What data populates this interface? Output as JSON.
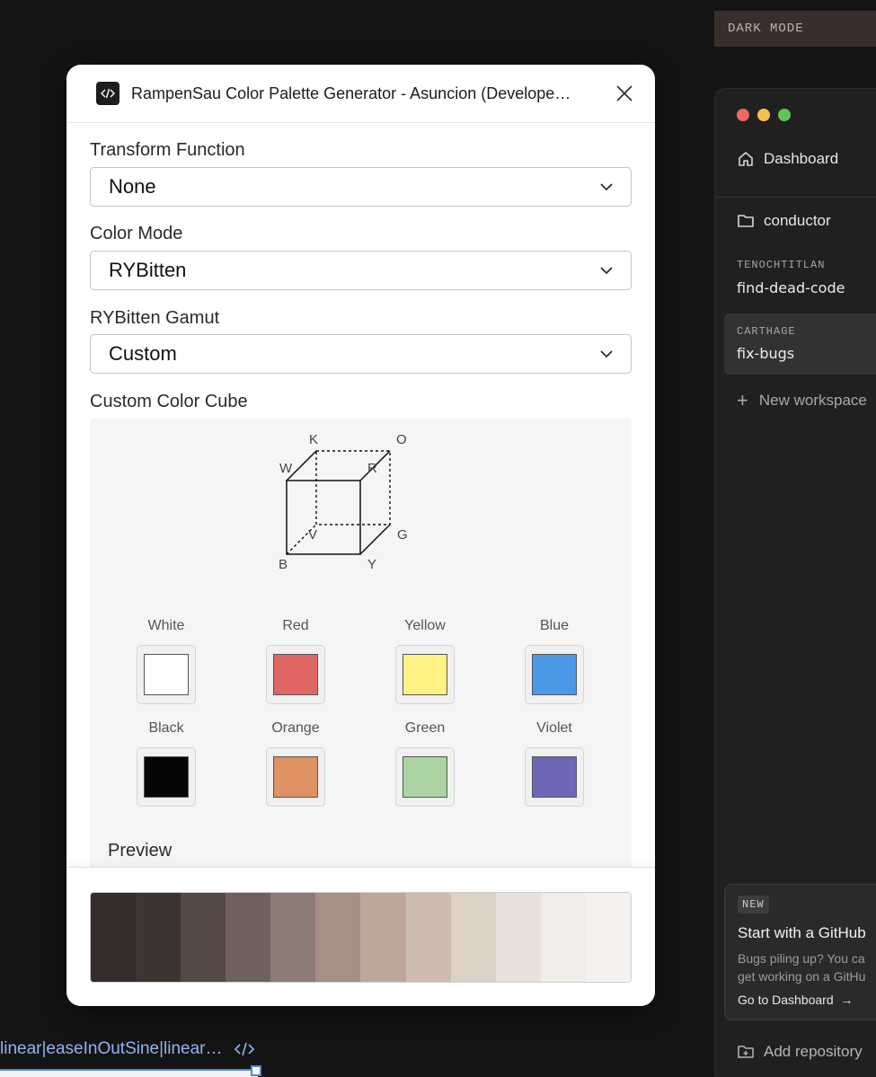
{
  "banner": {
    "label": "DARK MODE"
  },
  "sidebar": {
    "dashboard_label": "Dashboard",
    "repo_label": "conductor",
    "workspaces": [
      {
        "group": "TENOCHTITLAN",
        "name": "find-dead-code"
      },
      {
        "group": "CARTHAGE",
        "name": "fix-bugs"
      }
    ],
    "new_workspace_label": "New workspace",
    "card": {
      "badge": "NEW",
      "title": "Start with a GitHub",
      "body_line1": "Bugs piling up? You ca",
      "body_line2": "get working on a GitHu",
      "link_label": "Go to Dashboard"
    },
    "add_repository_label": "Add repository"
  },
  "modal": {
    "title": "RampenSau Color Palette Generator - Asuncion (Develope…",
    "transform_function": {
      "label": "Transform Function",
      "value": "None"
    },
    "color_mode": {
      "label": "Color Mode",
      "value": "RYBitten"
    },
    "gamut": {
      "label": "RYBitten Gamut",
      "value": "Custom"
    },
    "cube": {
      "label": "Custom Color Cube",
      "corner_labels": {
        "K": "K",
        "O": "O",
        "W": "W",
        "R": "R",
        "V": "V",
        "G": "G",
        "B": "B",
        "Y": "Y"
      }
    },
    "swatches": [
      {
        "name": "White",
        "color": "#ffffff"
      },
      {
        "name": "Red",
        "color": "#e06666"
      },
      {
        "name": "Yellow",
        "color": "#fdf282"
      },
      {
        "name": "Blue",
        "color": "#4a98e6"
      },
      {
        "name": "Black",
        "color": "#050505"
      },
      {
        "name": "Orange",
        "color": "#de9163"
      },
      {
        "name": "Green",
        "color": "#acd4a2"
      },
      {
        "name": "Violet",
        "color": "#6e67b7"
      }
    ],
    "preview_label": "Preview",
    "palette": [
      "#332c2a",
      "#3e3432",
      "#554845",
      "#6f605c",
      "#8d7b75",
      "#a88f86",
      "#bfa69b",
      "#cfbcb0",
      "#ddd1c6",
      "#e8e0da",
      "#f0ece7",
      "#f5f1ee"
    ]
  },
  "code_line": {
    "text": "linear|easeInOutSine|linear…"
  }
}
